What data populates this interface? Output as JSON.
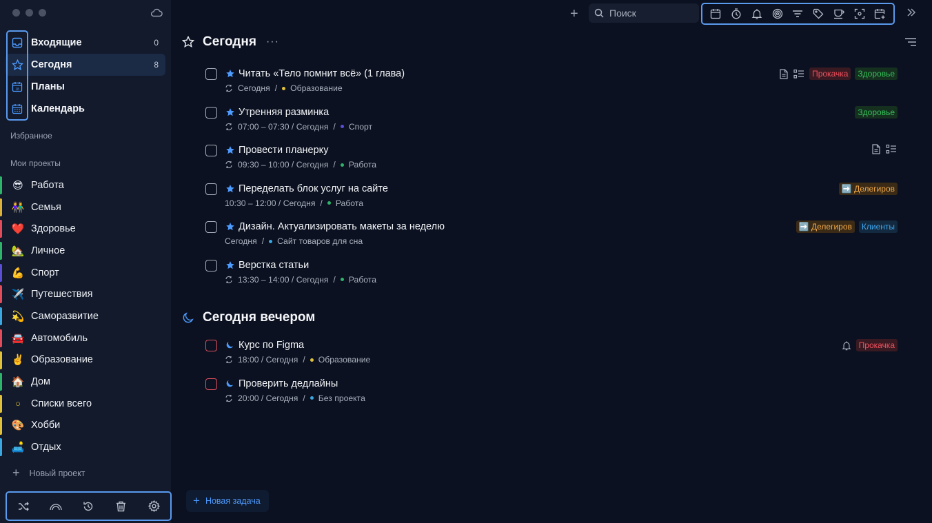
{
  "sidebar": {
    "nav": [
      {
        "label": "Входящие",
        "count": "0",
        "icon": "inbox-icon"
      },
      {
        "label": "Сегодня",
        "count": "8",
        "icon": "star-icon"
      },
      {
        "label": "Планы",
        "count": "",
        "icon": "calendar-day-icon"
      },
      {
        "label": "Календарь",
        "count": "",
        "icon": "calendar-grid-icon"
      }
    ],
    "favorites_title": "Избранное",
    "projects_title": "Мои проекты",
    "projects": [
      {
        "emoji": "😎",
        "label": "Работа",
        "color": "#2fb36a"
      },
      {
        "emoji": "👫",
        "label": "Семья",
        "color": "#d9b13b"
      },
      {
        "emoji": "❤️",
        "label": "Здоровье",
        "color": "#e04c5a"
      },
      {
        "emoji": "🏡",
        "label": "Личное",
        "color": "#2fb36a"
      },
      {
        "emoji": "💪",
        "label": "Спорт",
        "color": "#5a4fd4"
      },
      {
        "emoji": "✈️",
        "label": "Путешествия",
        "color": "#e04c5a"
      },
      {
        "emoji": "💫",
        "label": "Саморазвитие",
        "color": "#3aa7e0"
      },
      {
        "emoji": "🚘",
        "label": "Автомобиль",
        "color": "#e04c5a"
      },
      {
        "emoji": "✌️",
        "label": "Образование",
        "color": "#e0c13b"
      },
      {
        "emoji": "🏠",
        "label": "Дом",
        "color": "#2fb36a"
      },
      {
        "emoji": "○",
        "label": "Списки всего",
        "color": "#e0c13b"
      },
      {
        "emoji": "🎨",
        "label": "Хобби",
        "color": "#e0c13b"
      },
      {
        "emoji": "🛋️",
        "label": "Отдых",
        "color": "#3aa7e0"
      }
    ],
    "new_project": "Новый проект",
    "bottom_icons": [
      "shuffle-icon",
      "rainbow-icon",
      "history-icon",
      "trash-icon",
      "settings-icon"
    ]
  },
  "topbar": {
    "search_placeholder": "Поиск",
    "toolbar_icons": [
      "calendar-icon",
      "timer-icon",
      "bell-icon",
      "focus-icon",
      "filter-icon",
      "tag-icon",
      "cup-icon",
      "scan-icon",
      "add-calendar-icon"
    ]
  },
  "main": {
    "today_title": "Сегодня",
    "evening_title": "Сегодня вечером",
    "more_label": "···",
    "today_tasks": [
      {
        "title": "Читать «Тело помнит всё» (1 глава)",
        "time": "Сегодня",
        "project": "Образование",
        "project_color": "#e0c13b",
        "repeat": true,
        "has_note": true,
        "has_checklist": true,
        "has_bell": false,
        "tags": [
          {
            "text": "Прокачка",
            "style": "red"
          },
          {
            "text": "Здоровье",
            "style": "green"
          }
        ]
      },
      {
        "title": "Утренняя разминка",
        "time": "07:00 – 07:30 / Сегодня",
        "project": "Спорт",
        "project_color": "#5a4fd4",
        "repeat": true,
        "has_note": false,
        "has_checklist": false,
        "has_bell": false,
        "tags": [
          {
            "text": "Здоровье",
            "style": "green"
          }
        ]
      },
      {
        "title": "Провести планерку",
        "time": "09:30 – 10:00 / Сегодня",
        "project": "Работа",
        "project_color": "#2fb36a",
        "repeat": true,
        "has_note": true,
        "has_checklist": true,
        "has_bell": false,
        "tags": []
      },
      {
        "title": "Переделать блок услуг на сайте",
        "time": "10:30 – 12:00 / Сегодня",
        "project": "Работа",
        "project_color": "#2fb36a",
        "repeat": false,
        "has_note": false,
        "has_checklist": false,
        "has_bell": false,
        "tags": [
          {
            "text": "➡️ Делегиров",
            "style": "orange"
          }
        ]
      },
      {
        "title": "Дизайн. Актуализировать макеты за неделю",
        "time": "Сегодня",
        "project": "Сайт товаров для сна",
        "project_color": "#3aa7e0",
        "repeat": false,
        "has_note": false,
        "has_checklist": false,
        "has_bell": false,
        "tags": [
          {
            "text": "➡️ Делегиров",
            "style": "orange"
          },
          {
            "text": "Клиенты",
            "style": "blue"
          }
        ]
      },
      {
        "title": "Верстка статьи",
        "time": "13:30 – 14:00 / Сегодня",
        "project": "Работа",
        "project_color": "#2fb36a",
        "repeat": true,
        "has_note": false,
        "has_checklist": false,
        "has_bell": false,
        "tags": []
      }
    ],
    "evening_tasks": [
      {
        "title": "Курс по Figma",
        "time": "18:00 / Сегодня",
        "project": "Образование",
        "project_color": "#e0c13b",
        "repeat": true,
        "has_note": false,
        "has_checklist": false,
        "has_bell": true,
        "tags": [
          {
            "text": "Прокачка",
            "style": "red"
          }
        ]
      },
      {
        "title": "Проверить дедлайны",
        "time": "20:00 / Сегодня",
        "project": "Без проекта",
        "project_color": "#3aa7e0",
        "repeat": true,
        "has_note": false,
        "has_checklist": false,
        "has_bell": false,
        "tags": []
      }
    ],
    "new_task": "Новая задача"
  }
}
